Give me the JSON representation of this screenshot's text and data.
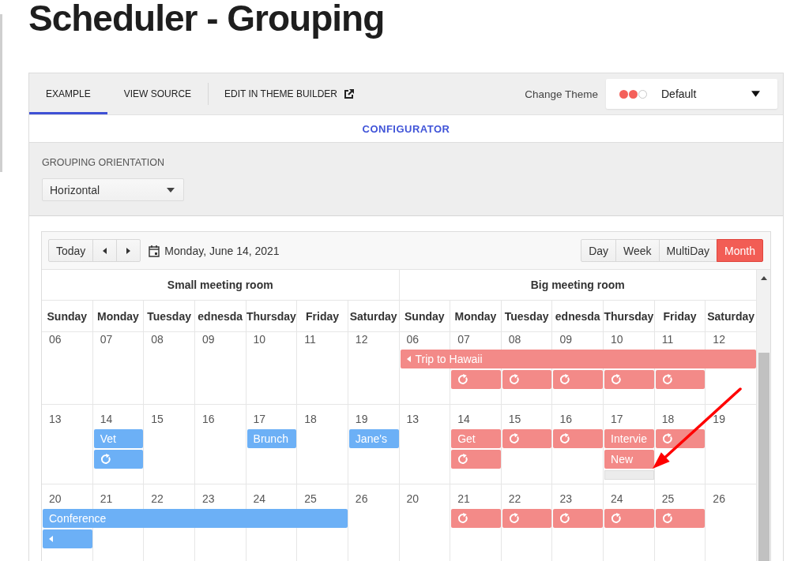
{
  "title": "Scheduler - Grouping",
  "tabs": [
    {
      "label": "EXAMPLE",
      "kind": "tab",
      "selected": true
    },
    {
      "label": "VIEW SOURCE",
      "kind": "tab",
      "selected": false
    },
    {
      "label": "EDIT IN THEME BUILDER",
      "kind": "link",
      "selected": false
    }
  ],
  "theme": {
    "label": "Change Theme",
    "value": "Default",
    "swatches": [
      {
        "color": "#f4605a"
      },
      {
        "color": "#f4605a"
      },
      {
        "color": "#ffffff"
      }
    ]
  },
  "configurator": {
    "title": "CONFIGURATOR",
    "field_label": "GROUPING ORIENTATION",
    "value": "Horizontal"
  },
  "scheduler": {
    "toolbar": {
      "today": "Today",
      "date": "Monday, June 14, 2021",
      "views": [
        {
          "label": "Day",
          "selected": false
        },
        {
          "label": "Week",
          "selected": false
        },
        {
          "label": "MultiDay",
          "selected": false
        },
        {
          "label": "Month",
          "selected": true
        }
      ]
    },
    "rooms": [
      {
        "name": "Small meeting room",
        "color": "#6cb0f6",
        "day_names": [
          "Sunday",
          "Monday",
          "Tuesday",
          "ednesda",
          "Thursday",
          "Friday",
          "Saturday"
        ]
      },
      {
        "name": "Big meeting room",
        "color": "#f38a88",
        "day_names": [
          "Sunday",
          "Monday",
          "Tuesday",
          "ednesda",
          "Thursday",
          "Friday",
          "Saturday"
        ]
      }
    ],
    "weeks": [
      {
        "rooms": [
          {
            "days": [
              {
                "date": "06"
              },
              {
                "date": "07"
              },
              {
                "date": "08"
              },
              {
                "date": "09"
              },
              {
                "date": "10"
              },
              {
                "date": "11"
              },
              {
                "date": "12"
              }
            ]
          },
          {
            "days": [
              {
                "date": "06",
                "events": [
                  {
                    "kind": "bar",
                    "title": "Trip to Hawaii",
                    "continues_before": true
                  }
                ]
              },
              {
                "date": "07",
                "events": [
                  {
                    "kind": "bar-continued"
                  },
                  {
                    "kind": "event",
                    "recurring": true
                  }
                ]
              },
              {
                "date": "08",
                "events": [
                  {
                    "kind": "bar-continued"
                  },
                  {
                    "kind": "event",
                    "recurring": true
                  }
                ]
              },
              {
                "date": "09",
                "events": [
                  {
                    "kind": "bar-continued"
                  },
                  {
                    "kind": "event",
                    "recurring": true
                  }
                ]
              },
              {
                "date": "10",
                "events": [
                  {
                    "kind": "bar-continued"
                  },
                  {
                    "kind": "event",
                    "recurring": true
                  }
                ]
              },
              {
                "date": "11",
                "events": [
                  {
                    "kind": "bar-continued"
                  },
                  {
                    "kind": "event",
                    "recurring": true
                  }
                ]
              },
              {
                "date": "12",
                "events": [
                  {
                    "kind": "bar-continued"
                  }
                ]
              }
            ]
          }
        ]
      },
      {
        "rooms": [
          {
            "days": [
              {
                "date": "13"
              },
              {
                "date": "14",
                "events": [
                  {
                    "kind": "event",
                    "title": "Vet",
                    "recurring": false
                  },
                  {
                    "kind": "event",
                    "recurring": true
                  }
                ]
              },
              {
                "date": "15"
              },
              {
                "date": "16"
              },
              {
                "date": "17",
                "events": [
                  {
                    "kind": "event",
                    "title": "Brunch",
                    "recurring": false
                  }
                ]
              },
              {
                "date": "18"
              },
              {
                "date": "19",
                "events": [
                  {
                    "kind": "event",
                    "title": "Jane's",
                    "recurring": false
                  }
                ]
              }
            ]
          },
          {
            "days": [
              {
                "date": "13"
              },
              {
                "date": "14",
                "events": [
                  {
                    "kind": "event",
                    "title": "Get",
                    "recurring": false
                  },
                  {
                    "kind": "event",
                    "recurring": true
                  }
                ]
              },
              {
                "date": "15",
                "events": [
                  {
                    "kind": "event",
                    "recurring": true
                  }
                ]
              },
              {
                "date": "16",
                "events": [
                  {
                    "kind": "event",
                    "recurring": true
                  }
                ]
              },
              {
                "date": "17",
                "events": [
                  {
                    "kind": "event",
                    "title": "Intervie",
                    "recurring": false
                  },
                  {
                    "kind": "event",
                    "title": "New",
                    "recurring": false
                  },
                  {
                    "kind": "more"
                  }
                ]
              },
              {
                "date": "18",
                "events": [
                  {
                    "kind": "event",
                    "recurring": true
                  }
                ]
              },
              {
                "date": "19"
              }
            ]
          }
        ]
      },
      {
        "rooms": [
          {
            "days": [
              {
                "date": "20",
                "events": [
                  {
                    "kind": "bar",
                    "title": "Conference",
                    "continues_before": false
                  },
                  {
                    "kind": "bar",
                    "continues_before": true
                  }
                ]
              },
              {
                "date": "21",
                "events": [
                  {
                    "kind": "bar-continued"
                  }
                ]
              },
              {
                "date": "22",
                "events": [
                  {
                    "kind": "bar-continued"
                  }
                ]
              },
              {
                "date": "23",
                "events": [
                  {
                    "kind": "bar-continued"
                  }
                ]
              },
              {
                "date": "24",
                "events": [
                  {
                    "kind": "bar-continued"
                  }
                ]
              },
              {
                "date": "25",
                "events": [
                  {
                    "kind": "bar-continued"
                  }
                ]
              },
              {
                "date": "26"
              }
            ]
          },
          {
            "days": [
              {
                "date": "20"
              },
              {
                "date": "21",
                "events": [
                  {
                    "kind": "event",
                    "recurring": true
                  }
                ]
              },
              {
                "date": "22",
                "events": [
                  {
                    "kind": "event",
                    "recurring": true
                  }
                ]
              },
              {
                "date": "23",
                "events": [
                  {
                    "kind": "event",
                    "recurring": true
                  }
                ]
              },
              {
                "date": "24",
                "events": [
                  {
                    "kind": "event",
                    "recurring": true
                  }
                ]
              },
              {
                "date": "25",
                "events": [
                  {
                    "kind": "event",
                    "recurring": true
                  }
                ]
              },
              {
                "date": "26"
              }
            ]
          }
        ]
      }
    ]
  }
}
